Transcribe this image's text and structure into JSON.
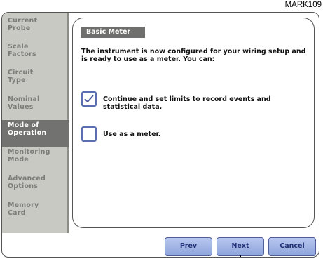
{
  "mark": "MARK109",
  "sidebar": {
    "items": [
      {
        "label": "Current\nProbe",
        "active": false
      },
      {
        "label": "Scale\nFactors",
        "active": false
      },
      {
        "label": "Circuit\nType",
        "active": false
      },
      {
        "label": "Nominal\nValues",
        "active": false
      },
      {
        "label": "Mode of\nOperation",
        "active": true
      },
      {
        "label": "Monitoring\nMode",
        "active": false
      },
      {
        "label": "Advanced\nOptions",
        "active": false
      },
      {
        "label": "Memory\nCard",
        "active": false
      }
    ]
  },
  "panel": {
    "title": "Basic Meter",
    "intro": "The instrument is now configured for your wiring setup and is ready to use as a meter. You can:",
    "options": [
      {
        "label": "Continue and set limits to record events and statistical data.",
        "checked": true
      },
      {
        "label": "Use as a meter.",
        "checked": false
      }
    ]
  },
  "buttons": {
    "prev": "Prev",
    "next": "Next",
    "cancel": "Cancel"
  },
  "colors": {
    "sidebar_bg": "#c9c9c4",
    "active_item_bg": "#727270",
    "button_fill": "#a9b9e8",
    "checkbox_border": "#5a6fb0"
  }
}
